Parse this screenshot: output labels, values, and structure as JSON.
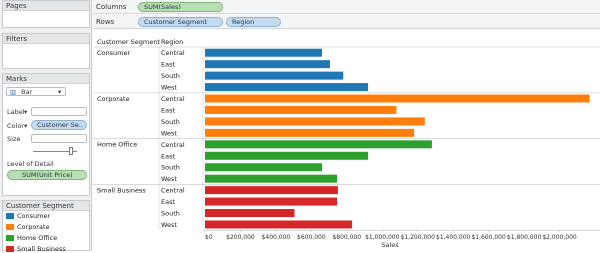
{
  "shelves": {
    "pages_label": "Pages",
    "columns_label": "Columns",
    "columns_pill": "SUM(Sales)",
    "rows_label": "Rows",
    "rows_pills": [
      "Customer Segment",
      "Region"
    ]
  },
  "filters": {
    "title": "Filters"
  },
  "marks": {
    "title": "Marks",
    "mark_type": "Bar",
    "label_text": "Label",
    "color_text": "Color",
    "color_pill": "Customer Se..",
    "size_text": "Size",
    "detail_title": "Level of Detail",
    "detail_pill": "SUM(Unit Price)"
  },
  "legend": {
    "title": "Customer Segment",
    "items": [
      {
        "label": "Consumer",
        "color": "#1f77b4"
      },
      {
        "label": "Corporate",
        "color": "#ff7f0e"
      },
      {
        "label": "Home Office",
        "color": "#2ca02c"
      },
      {
        "label": "Small Business",
        "color": "#d62728"
      }
    ]
  },
  "chart_data": {
    "type": "bar",
    "orientation": "horizontal",
    "row_headers": [
      "Customer Segment",
      "Region"
    ],
    "xlabel": "Sales",
    "xlim": [
      0,
      2200000
    ],
    "xticks": [
      "$0",
      "$200,000",
      "$400,000",
      "$600,000",
      "$800,000",
      "$1,000,000",
      "$1,200,000",
      "$1,400,000",
      "$1,600,000",
      "$1,800,000",
      "$2,000,000"
    ],
    "grid": false,
    "groups": [
      {
        "name": "Consumer",
        "color": "#1f77b4",
        "rows": [
          {
            "region": "Central",
            "value": 660000
          },
          {
            "region": "East",
            "value": 705000
          },
          {
            "region": "South",
            "value": 780000
          },
          {
            "region": "West",
            "value": 920000
          }
        ]
      },
      {
        "name": "Corporate",
        "color": "#ff7f0e",
        "rows": [
          {
            "region": "Central",
            "value": 2170000
          },
          {
            "region": "East",
            "value": 1080000
          },
          {
            "region": "South",
            "value": 1240000
          },
          {
            "region": "West",
            "value": 1180000
          }
        ]
      },
      {
        "name": "Home Office",
        "color": "#2ca02c",
        "rows": [
          {
            "region": "Central",
            "value": 1280000
          },
          {
            "region": "East",
            "value": 920000
          },
          {
            "region": "South",
            "value": 660000
          },
          {
            "region": "West",
            "value": 745000
          }
        ]
      },
      {
        "name": "Small Business",
        "color": "#d62728",
        "rows": [
          {
            "region": "Central",
            "value": 750000
          },
          {
            "region": "East",
            "value": 745000
          },
          {
            "region": "South",
            "value": 505000
          },
          {
            "region": "West",
            "value": 830000
          }
        ]
      }
    ]
  }
}
